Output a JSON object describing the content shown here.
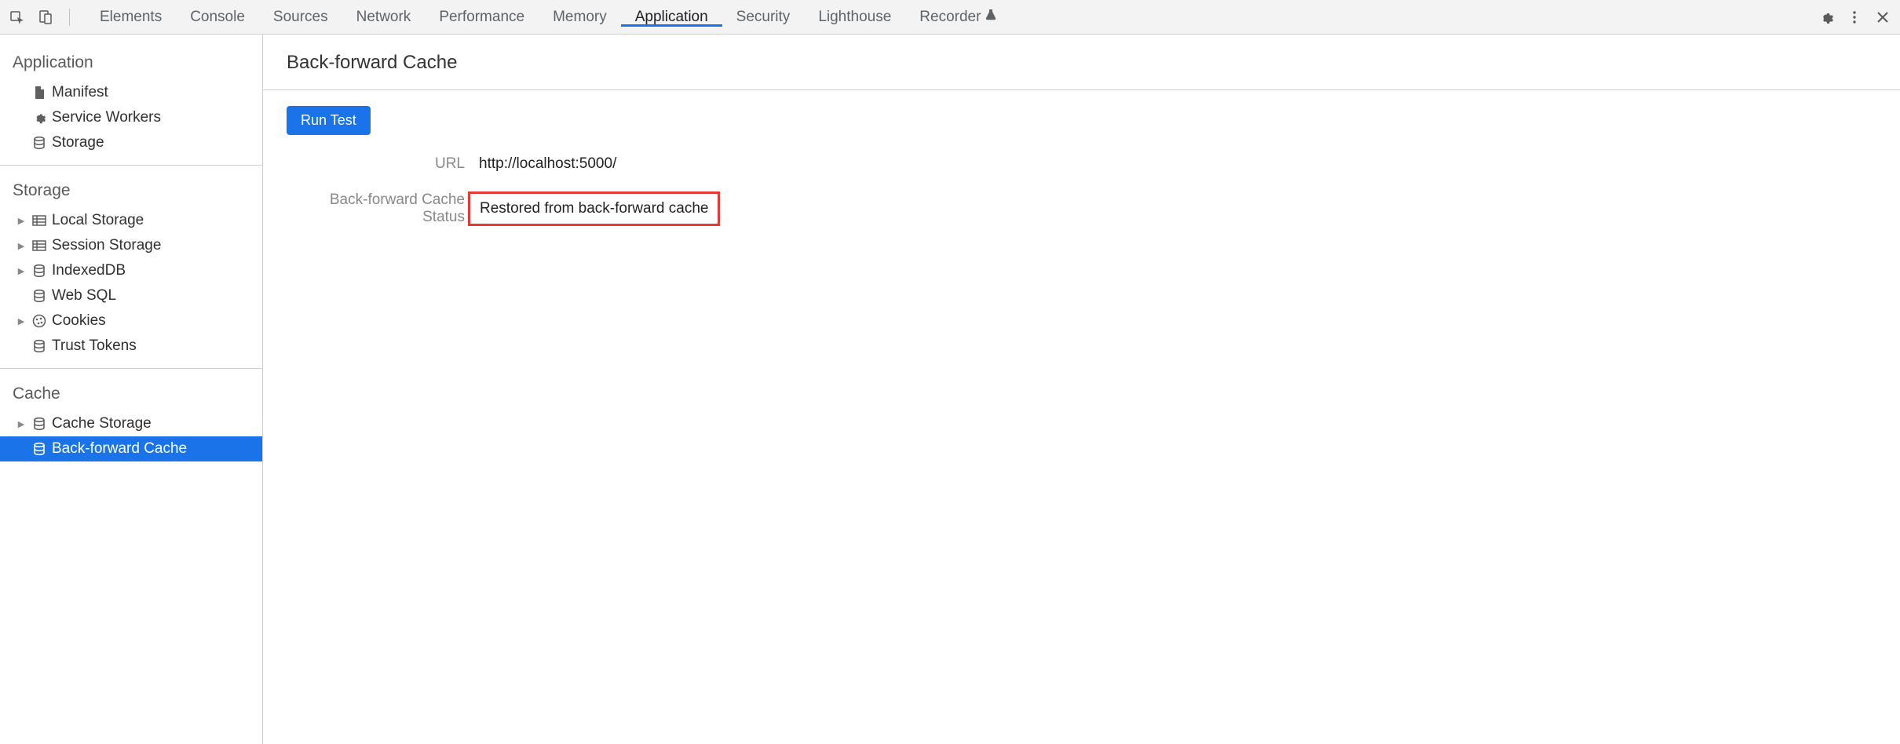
{
  "tabs": {
    "elements": "Elements",
    "console": "Console",
    "sources": "Sources",
    "network": "Network",
    "performance": "Performance",
    "memory": "Memory",
    "application": "Application",
    "security": "Security",
    "lighthouse": "Lighthouse",
    "recorder": "Recorder"
  },
  "sidebar": {
    "sections": {
      "application": {
        "title": "Application",
        "items": {
          "manifest": "Manifest",
          "service_workers": "Service Workers",
          "storage": "Storage"
        }
      },
      "storage": {
        "title": "Storage",
        "items": {
          "local_storage": "Local Storage",
          "session_storage": "Session Storage",
          "indexeddb": "IndexedDB",
          "web_sql": "Web SQL",
          "cookies": "Cookies",
          "trust_tokens": "Trust Tokens"
        }
      },
      "cache": {
        "title": "Cache",
        "items": {
          "cache_storage": "Cache Storage",
          "back_forward_cache": "Back-forward Cache"
        }
      }
    }
  },
  "main": {
    "title": "Back-forward Cache",
    "run_test_label": "Run Test",
    "fields": {
      "url_label": "URL",
      "url_value": "http://localhost:5000/",
      "status_label": "Back-forward Cache Status",
      "status_value": "Restored from back-forward cache"
    }
  }
}
